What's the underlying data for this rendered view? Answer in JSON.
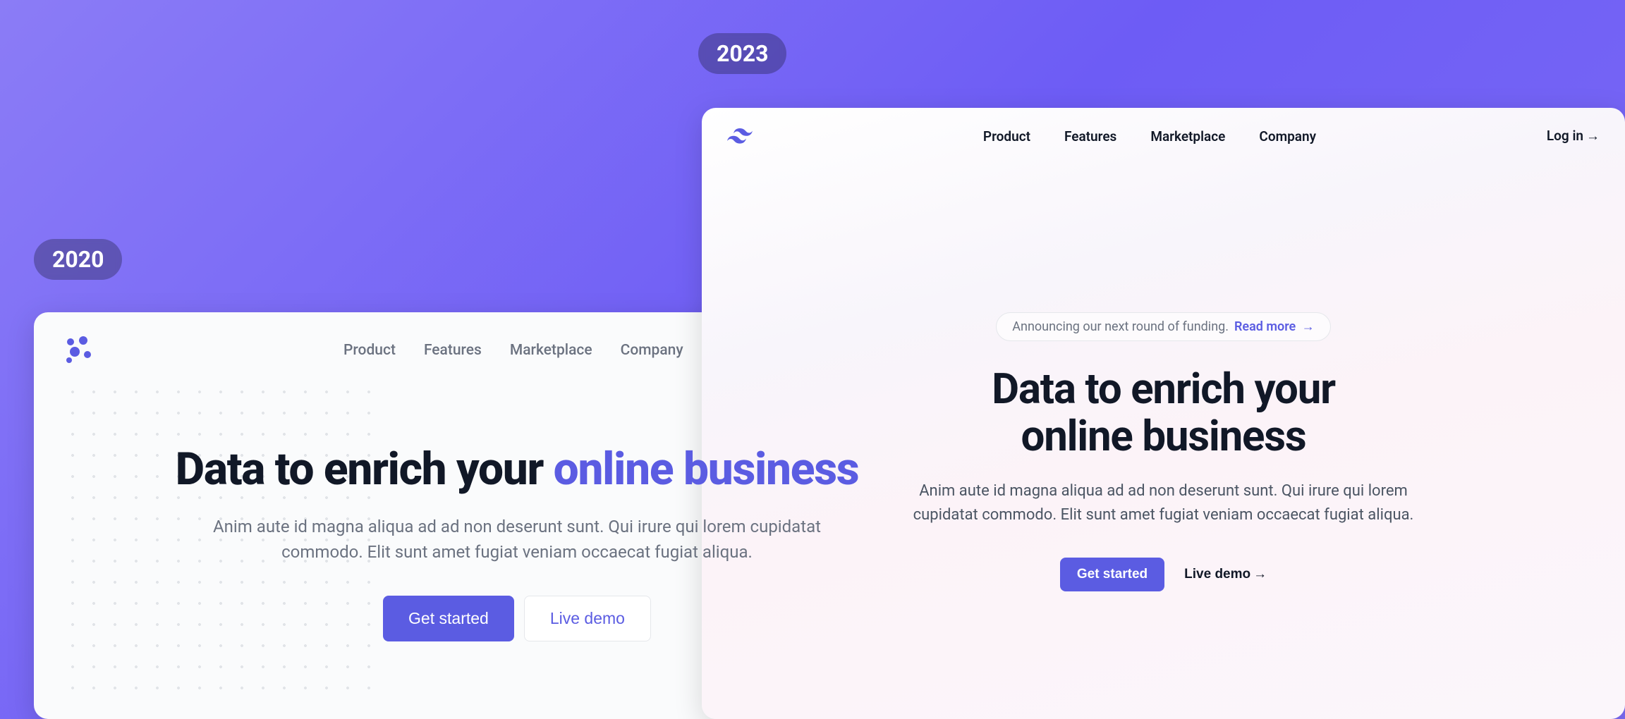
{
  "badges": {
    "left": "2020",
    "right": "2023"
  },
  "card2020": {
    "nav": {
      "items": [
        "Product",
        "Features",
        "Marketplace",
        "Company"
      ]
    },
    "hero": {
      "title_part1": "Data to enrich your ",
      "title_accent": "online business",
      "description": "Anim aute id magna aliqua ad ad non deserunt sunt. Qui irure qui lorem cupidatat commodo. Elit sunt amet fugiat veniam occaecat fugiat aliqua.",
      "cta_primary": "Get started",
      "cta_secondary": "Live demo"
    }
  },
  "card2023": {
    "nav": {
      "items": [
        "Product",
        "Features",
        "Marketplace",
        "Company"
      ],
      "login": "Log in",
      "login_arrow": "→"
    },
    "hero": {
      "announcement_text": "Announcing our next round of funding.",
      "announcement_link": "Read more",
      "announcement_arrow": "→",
      "title_line1": "Data to enrich your",
      "title_line2": "online business",
      "description": "Anim aute id magna aliqua ad ad non deserunt sunt. Qui irure qui lorem cupidatat commodo. Elit sunt amet fugiat veniam occaecat fugiat aliqua.",
      "cta_primary": "Get started",
      "cta_secondary": "Live demo",
      "cta_secondary_arrow": "→"
    }
  },
  "colors": {
    "accent": "#5b5ce2",
    "text_dark": "#111827",
    "text_muted": "#6b7280"
  }
}
